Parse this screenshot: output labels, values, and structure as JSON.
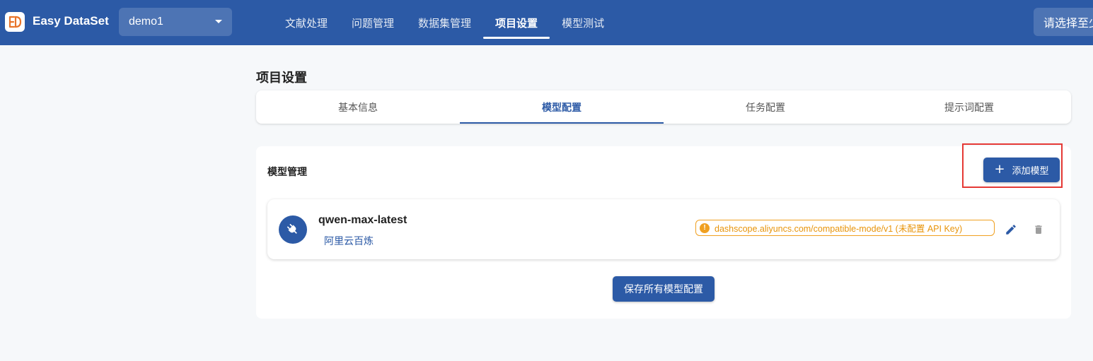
{
  "header": {
    "brand": "Easy DataSet",
    "project_select": {
      "value": "demo1"
    },
    "nav": [
      {
        "label": "文献处理",
        "active": false
      },
      {
        "label": "问题管理",
        "active": false
      },
      {
        "label": "数据集管理",
        "active": false
      },
      {
        "label": "项目设置",
        "active": true
      },
      {
        "label": "模型测试",
        "active": false
      }
    ],
    "model_select_label": "请选择至少"
  },
  "page": {
    "title": "项目设置",
    "tabs": [
      {
        "label": "基本信息",
        "active": false
      },
      {
        "label": "模型配置",
        "active": true
      },
      {
        "label": "任务配置",
        "active": false
      },
      {
        "label": "提示词配置",
        "active": false
      }
    ]
  },
  "model_management": {
    "title": "模型管理",
    "add_button_label": "添加模型",
    "models": [
      {
        "name": "qwen-max-latest",
        "provider": "阿里云百炼",
        "endpoint": "dashscope.aliyuncs.com/compatible-mode/v1 (未配置 API Key)"
      }
    ],
    "save_button_label": "保存所有模型配置"
  },
  "colors": {
    "primary": "#2c5aa6",
    "warning": "#f0a020",
    "highlight": "#e53935"
  }
}
